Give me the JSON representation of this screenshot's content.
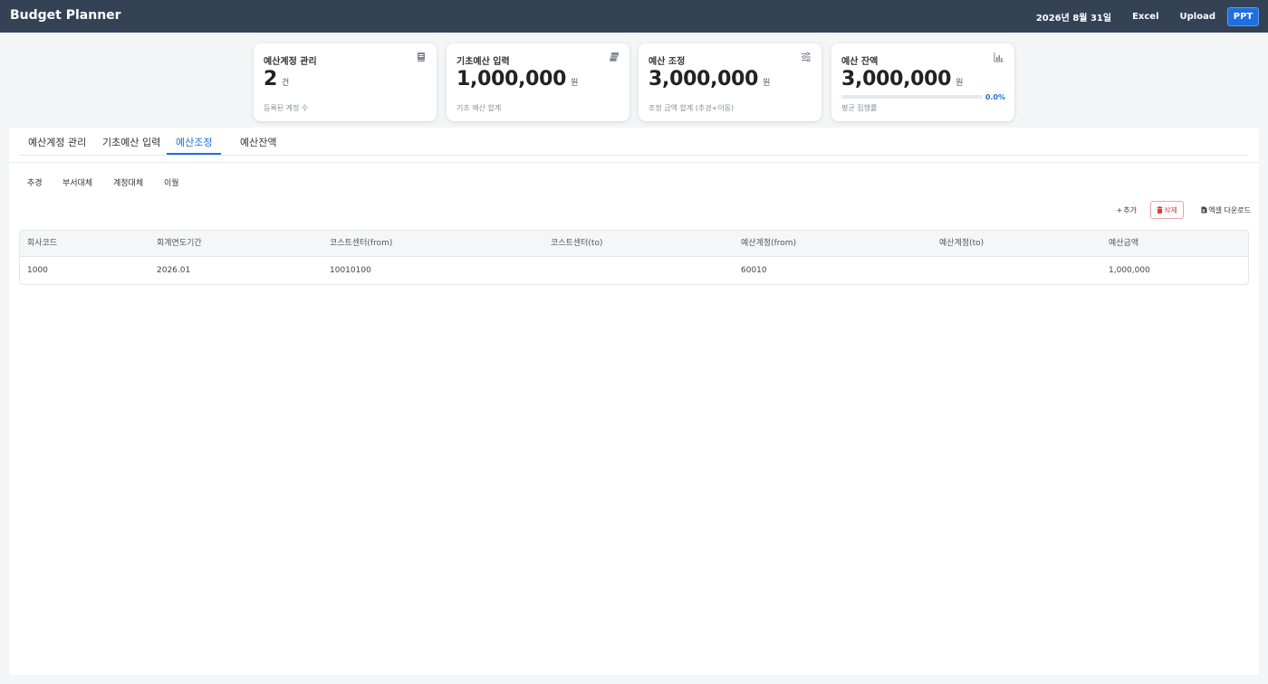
{
  "header": {
    "title": "Budget Planner",
    "date": "2026년 8월 31일",
    "excel_label": "Excel",
    "upload_label": "Upload",
    "ppt_label": "PPT"
  },
  "cards": [
    {
      "title": "예산계정 관리",
      "icon": "book-icon",
      "value": "2",
      "unit": "건",
      "caption": "등록된 계정 수"
    },
    {
      "title": "기초예산 입력",
      "icon": "money-stack-icon",
      "value": "1,000,000",
      "unit": "원",
      "caption": "기초 예산 합계"
    },
    {
      "title": "예산 조정",
      "icon": "sliders-icon",
      "value": "3,000,000",
      "unit": "원",
      "caption": "조정 금액 합계 (추경+이동)"
    },
    {
      "title": "예산 잔액",
      "icon": "chart-icon",
      "value": "3,000,000",
      "unit": "원",
      "caption": "평균 집행률",
      "progress_pct": "0.0%",
      "progress_fraction": 0.0
    }
  ],
  "tabs": [
    "예산계정 관리",
    "기초예산 입력",
    "예산조정",
    "예산잔액"
  ],
  "active_tab": "예산조정",
  "subtabs": [
    "추경",
    "부서대체",
    "계정대체",
    "이월"
  ],
  "actions": {
    "add_label": "추가",
    "delete_label": "삭제",
    "download_label": "엑셀 다운로드"
  },
  "table": {
    "columns": [
      "회사코드",
      "회계연도기간",
      "코스트센터(from)",
      "코스트센터(to)",
      "예산계정(from)",
      "예산계정(to)",
      "예산금액"
    ],
    "rows": [
      [
        "1000",
        "2026.01",
        "10010100",
        "",
        "60010",
        "",
        "1,000,000"
      ]
    ]
  },
  "colors": {
    "topbar": "#344256",
    "accent": "#1f6fe0",
    "danger": "#e23b3b"
  }
}
